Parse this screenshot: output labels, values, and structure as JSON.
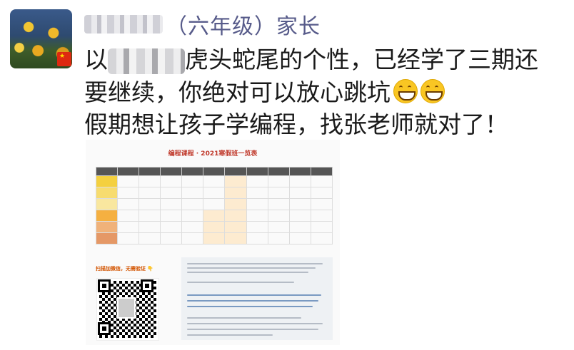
{
  "post": {
    "author_visible": "（六年级）家长",
    "line1_prefix": "以",
    "line1_rest": "虎头蛇尾的个性，已经学了三期还",
    "line2": "要继续，你绝对可以放心跳坑",
    "line3": "假期想让孩子学编程，找张老师就对了！",
    "emoji": "grinning-face-icon"
  },
  "image": {
    "title": "编程课程 · 2021寒假班一览表",
    "qr_caption": "扫描加微信，无需验证 👇"
  },
  "colors": {
    "author_name": "#575b8a",
    "text": "#1a1a1a",
    "flag": "#de2910"
  }
}
